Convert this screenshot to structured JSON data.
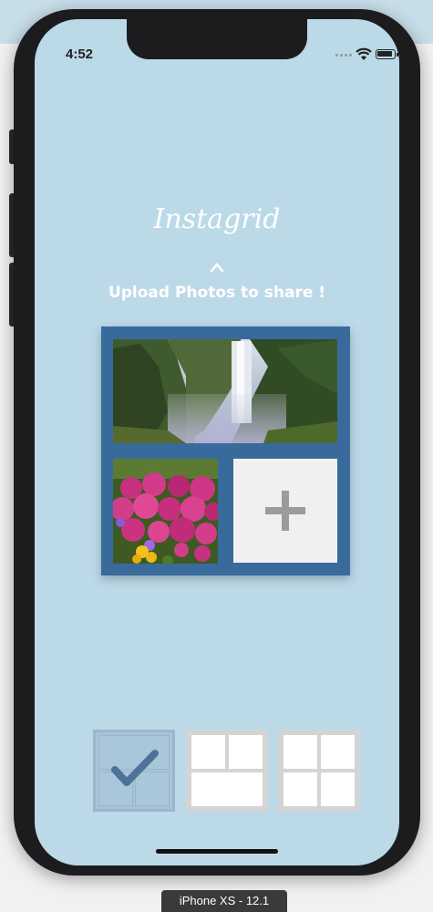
{
  "status_bar": {
    "time": "4:52"
  },
  "app": {
    "title": "Instagrid",
    "swipe_caret": "^",
    "instruction": "Upload Photos to share !"
  },
  "grid": {
    "photos": [
      {
        "name": "waterfall-photo"
      },
      {
        "name": "flowers-photo"
      }
    ],
    "add_button_icon": "plus-icon"
  },
  "layouts": [
    {
      "name": "layout-one-top-two-bottom",
      "selected": true,
      "icon": "checkmark-icon"
    },
    {
      "name": "layout-two-top-one-bottom",
      "selected": false
    },
    {
      "name": "layout-four-squares",
      "selected": false
    }
  ],
  "simulator": {
    "device_label": "iPhone XS - 12.1"
  },
  "colors": {
    "screen_bg": "#bcd9e8",
    "grid_frame": "#386b9c",
    "selected_layout": "#a6c3d8",
    "text": "#ffffff"
  }
}
